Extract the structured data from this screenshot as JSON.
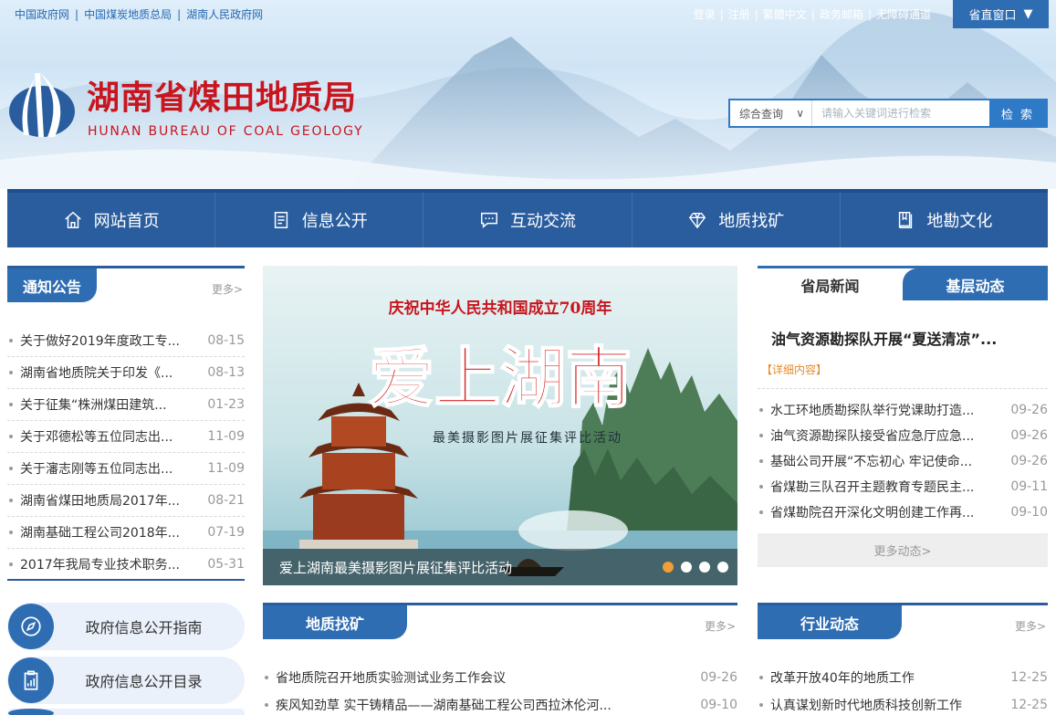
{
  "top_links": [
    "中国政府网",
    "中国煤炭地质总局",
    "湖南人民政府网"
  ],
  "user_links": [
    "登录",
    "注册",
    "繁體中文",
    "政务邮箱",
    "无障碍通道"
  ],
  "province_window": "省直窗口",
  "site": {
    "name": "湖南省煤田地质局",
    "name_en": "HUNAN BUREAU OF COAL GEOLOGY"
  },
  "search": {
    "scope": "综合查询",
    "placeholder": "请输入关键词进行检索",
    "button": "检 索"
  },
  "nav": [
    {
      "label": "网站首页",
      "icon": "home-icon"
    },
    {
      "label": "信息公开",
      "icon": "document-icon"
    },
    {
      "label": "互动交流",
      "icon": "chat-icon"
    },
    {
      "label": "地质找矿",
      "icon": "diamond-icon"
    },
    {
      "label": "地勘文化",
      "icon": "book-icon"
    }
  ],
  "notice": {
    "title": "通知公告",
    "more": "更多>",
    "items": [
      {
        "title": "关于做好2019年度政工专...",
        "date": "08-15"
      },
      {
        "title": "湖南省地质院关于印发《...",
        "date": "08-13"
      },
      {
        "title": "关于征集“株洲煤田建筑...",
        "date": "01-23"
      },
      {
        "title": "关于邓德松等五位同志出...",
        "date": "11-09"
      },
      {
        "title": "关于瀋志刚等五位同志出...",
        "date": "11-09"
      },
      {
        "title": "湖南省煤田地质局2017年...",
        "date": "08-21"
      },
      {
        "title": "湖南基础工程公司2018年...",
        "date": "07-19"
      },
      {
        "title": "2017年我局专业技术职务...",
        "date": "05-31"
      }
    ]
  },
  "slider": {
    "banner_top": "庆祝中华人民共和国成立70周年",
    "banner_main": "爱上湖南",
    "banner_sub": "最美摄影图片展征集评比活动",
    "caption": "爱上湖南最美摄影图片展征集评比活动",
    "active_index": 0,
    "count": 4
  },
  "news": {
    "tab_active": "省局新闻",
    "tab_other": "基层动态",
    "headline": "油气资源勘探队开展“夏送清凉”...",
    "detail": "【详细内容】",
    "items": [
      {
        "title": "水工环地质勘探队举行党课助打造...",
        "date": "09-26"
      },
      {
        "title": "油气资源勘探队接受省应急厅应急...",
        "date": "09-26"
      },
      {
        "title": "基础公司开展“不忘初心 牢记使命...",
        "date": "09-26"
      },
      {
        "title": "省煤勘三队召开主题教育专题民主...",
        "date": "09-11"
      },
      {
        "title": "省煤勘院召开深化文明创建工作再...",
        "date": "09-10"
      }
    ],
    "more": "更多动态>"
  },
  "gov_buttons": [
    {
      "label": "政府信息公开指南",
      "icon": "compass-icon"
    },
    {
      "label": "政府信息公开目录",
      "icon": "clipboard-icon"
    }
  ],
  "geology": {
    "title": "地质找矿",
    "more": "更多>",
    "items": [
      {
        "title": "省地质院召开地质实验测试业务工作会议",
        "date": "09-26"
      },
      {
        "title": "疾风知劲草 实干铸精品——湖南基础工程公司西拉沐伦河...",
        "date": "09-10"
      }
    ]
  },
  "industry": {
    "title": "行业动态",
    "more": "更多>",
    "items": [
      {
        "title": "改革开放40年的地质工作",
        "date": "12-25"
      },
      {
        "title": "认真谋划新时代地质科技创新工作",
        "date": "12-25"
      }
    ]
  },
  "colors": {
    "primary": "#2f6db2",
    "nav": "#2a5d9e",
    "brand_red": "#c8151e",
    "accent_orange": "#f29d38"
  }
}
